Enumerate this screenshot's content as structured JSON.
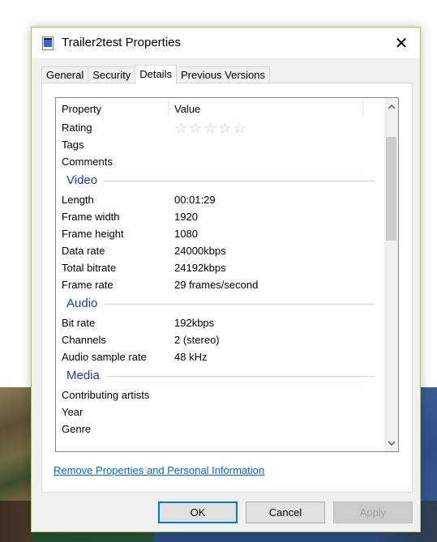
{
  "window": {
    "title": "Trailer2test Properties",
    "close_glyph": "✕"
  },
  "tabs": [
    {
      "label": "General"
    },
    {
      "label": "Security"
    },
    {
      "label": "Details",
      "active": true
    },
    {
      "label": "Previous Versions"
    }
  ],
  "list": {
    "header": {
      "property": "Property",
      "value": "Value"
    },
    "top_rows": [
      {
        "key": "Rating",
        "value": "",
        "stars": "☆☆☆☆☆",
        "rating": 0
      },
      {
        "key": "Tags",
        "value": ""
      },
      {
        "key": "Comments",
        "value": ""
      }
    ],
    "video": {
      "title": "Video",
      "rows": [
        {
          "key": "Length",
          "value": "00:01:29"
        },
        {
          "key": "Frame width",
          "value": "1920"
        },
        {
          "key": "Frame height",
          "value": "1080"
        },
        {
          "key": "Data rate",
          "value": "24000kbps"
        },
        {
          "key": "Total bitrate",
          "value": "24192kbps"
        },
        {
          "key": "Frame rate",
          "value": "29 frames/second"
        }
      ]
    },
    "audio": {
      "title": "Audio",
      "rows": [
        {
          "key": "Bit rate",
          "value": "192kbps"
        },
        {
          "key": "Channels",
          "value": "2 (stereo)"
        },
        {
          "key": "Audio sample rate",
          "value": "48 kHz"
        }
      ]
    },
    "media": {
      "title": "Media",
      "rows": [
        {
          "key": "Contributing artists",
          "value": ""
        },
        {
          "key": "Year",
          "value": ""
        },
        {
          "key": "Genre",
          "value": ""
        }
      ]
    }
  },
  "link_text": "Remove Properties and Personal Information",
  "buttons": {
    "ok": "OK",
    "cancel": "Cancel",
    "apply": "Apply"
  },
  "colors": {
    "accent": "#0078d7",
    "group_heading": "#1e3c96",
    "link": "#0066cc",
    "window_border": "#a9c94f"
  }
}
